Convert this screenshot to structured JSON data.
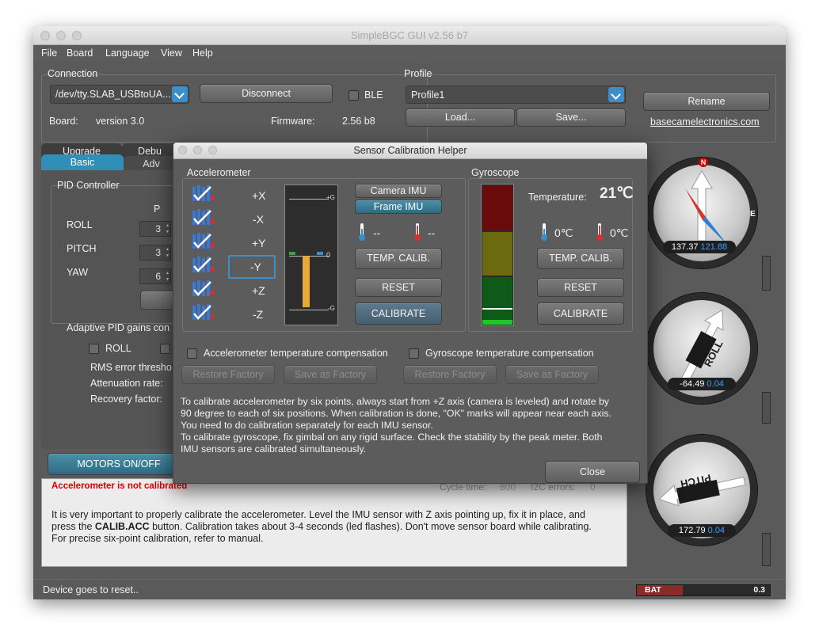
{
  "window": {
    "title": "SimpleBGC GUI v2.56 b7"
  },
  "menu": [
    "File",
    "Board",
    "Language",
    "View",
    "Help"
  ],
  "connection": {
    "section_label": "Connection",
    "port": "/dev/tty.SLAB_USBtoUA...",
    "disconnect_label": "Disconnect",
    "ble_label": "BLE",
    "board_label": "Board:",
    "board_value": "version 3.0",
    "firmware_label": "Firmware:",
    "firmware_value": "2.56 b8"
  },
  "profile": {
    "section_label": "Profile",
    "selected": "Profile1",
    "load_label": "Load...",
    "save_label": "Save...",
    "rename_label": "Rename",
    "website": "basecamelectronics.com"
  },
  "tabs": {
    "upgrade": "Upgrade",
    "debug": "Debu",
    "basic": "Basic",
    "adv": "Adv"
  },
  "pid": {
    "title": "PID Controller",
    "p_header": "P",
    "rows": [
      {
        "label": "ROLL",
        "p": "3"
      },
      {
        "label": "PITCH",
        "p": "3"
      },
      {
        "label": "YAW",
        "p": "6"
      }
    ],
    "adaptive_label": "Adaptive PID gains con",
    "roll_label": "ROLL",
    "rms_label": "RMS error thresho",
    "attenuation_label": "Attenuation rate:",
    "recovery_label": "Recovery factor:"
  },
  "motors_label": "MOTORS ON/OFF",
  "status": {
    "warning": "Accelerometer is not calibrated",
    "cycle_time_label": "Cycle time:",
    "cycle_time_value": "800",
    "i2c_label": "I2C errors:",
    "i2c_value": "0",
    "message_part1": "It is very important to properly calibrate the accelerometer. Level the IMU sensor with Z axis pointing up, fix it in place, and press the ",
    "message_bold": "CALIB.ACC",
    "message_part2": " button. Calibration takes about 3-4 seconds (led flashes). Don't move sensor board while calibrating. For precise six-point calibration, refer to manual."
  },
  "bottom_status": "Device goes to reset..",
  "battery": {
    "label": "BAT",
    "value": "0.3"
  },
  "dialog": {
    "title": "Sensor Calibration Helper",
    "accelerometer_label": "Accelerometer",
    "gyroscope_label": "Gyroscope",
    "axes": [
      "+X",
      "-X",
      "+Y",
      "-Y",
      "+Z",
      "-Z"
    ],
    "selected_axis": "-Y",
    "scale_top": "+G",
    "scale_mid": "0",
    "scale_bot": "-G",
    "camera_imu_label": "Camera IMU",
    "frame_imu_label": "Frame IMU",
    "acc_temp_min": "--",
    "acc_temp_max": "--",
    "temp_calib_label": "TEMP. CALIB.",
    "reset_label": "RESET",
    "calibrate_label": "CALIBRATE",
    "temperature_label": "Temperature:",
    "temperature_value": "21℃",
    "gyro_temp_min": "0℃",
    "gyro_temp_max": "0℃",
    "acc_temp_comp_label": "Accelerometer temperature compensation",
    "gyro_temp_comp_label": "Gyroscope temperature compensation",
    "restore_factory_label": "Restore Factory",
    "save_as_factory_label": "Save as Factory",
    "help_text": "To calibrate accelerometer by six points, always start from +Z axis (camera is leveled) and rotate by 90 degree to each of six positions. When calibration is done, \"OK\" marks will appear near each axis. You need to do calibration separately for each IMU sensor.\nTo calibrate gyroscope, fix gimbal on any rigid surface. Check the stability by the peak meter. Both IMU sensors are calibrated simultaneously.",
    "close_label": "Close",
    "accel_level": 0.95
  },
  "gauges": {
    "yaw": {
      "north": "N",
      "east": "E",
      "value": "137.37",
      "speed": "121.88"
    },
    "roll": {
      "label": "ROLL",
      "value": "-64.49",
      "speed": "0.04"
    },
    "pitch": {
      "label": "PITCH",
      "value": "172.79",
      "speed": "0.04"
    }
  },
  "colors": {
    "accent_blue": "#3a8fcb",
    "warning_red": "#d40000",
    "gauge_value_blue": "#3aa0ff"
  }
}
